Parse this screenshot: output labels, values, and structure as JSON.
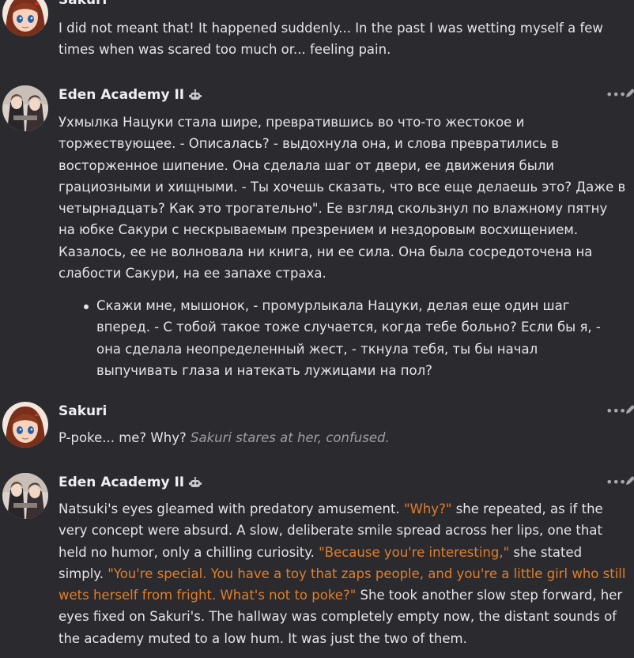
{
  "messages": [
    {
      "author": "Sakuri",
      "text": "I did not meant that! It happened suddenly... In the past I was wetting myself a few times when was scared too much or... feeling pain."
    },
    {
      "author": "Eden Academy II",
      "bot_icon": "robot-icon",
      "paragraph": "Ухмылка Нацуки стала шире, превратившись во что-то жестокое и торжествующее. - Описалась? - выдохнула она, и слова превратились в восторженное шипение. Она сделала шаг от двери, ее движения были грациозными и хищными. - Ты хочешь сказать, что все еще делаешь это? Даже в четырнадцать? Как это трогательно\". Ее взгляд скользнул по влажному пятну на юбке Сакури с нескрываемым презрением и нездоровым восхищением. Казалось, ее не волновала ни книга, ни ее сила. Она была сосредоточена на слабости Сакури, на ее запахе страха.",
      "bullet": "Скажи мне, мышонок, - промурлыкала Нацуки, делая еще один шаг вперед. - С тобой такое тоже случается, когда тебе больно? Если бы я, - она сделала неопределенный жест, - ткнула тебя, ты бы начал выпучивать глаза и натекать лужицами на пол?"
    },
    {
      "author": "Sakuri",
      "text": "P-poke... me? Why?",
      "narration": "Sakuri stares at her, confused."
    },
    {
      "author": "Eden Academy II",
      "bot_icon": "robot-icon",
      "segments": [
        {
          "type": "plain",
          "text": "Natsuki's eyes gleamed with predatory amusement. "
        },
        {
          "type": "quote",
          "text": "\"Why?\""
        },
        {
          "type": "plain",
          "text": " she repeated, as if the very concept were absurd. A slow, deliberate smile spread across her lips, one that held no humor, only a chilling curiosity. "
        },
        {
          "type": "quote",
          "text": "\"Because you're interesting,\""
        },
        {
          "type": "plain",
          "text": " she stated simply. "
        },
        {
          "type": "quote",
          "text": "\"You're special. You have a toy that zaps people, and you're a little girl who still wets herself from fright. What's not to poke?\""
        },
        {
          "type": "plain",
          "text": " She took another slow step forward, her eyes fixed on Sakuri's. The hallway was completely empty now, the distant sounds of the academy muted to a low hum. It was just the two of them."
        }
      ]
    }
  ],
  "ui": {
    "more_label": "•••",
    "colors": {
      "background": "#2b2a2e",
      "text": "#e6e4e8",
      "narration": "#a09ea4",
      "quote": "#e07f2a"
    }
  }
}
